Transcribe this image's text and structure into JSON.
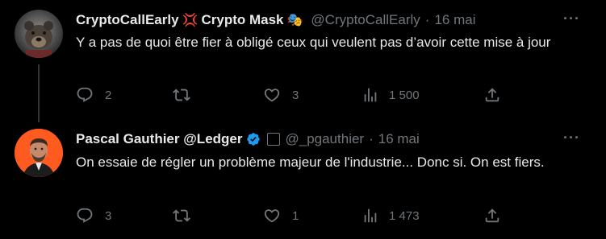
{
  "tweets": [
    {
      "display_name": "CryptoCallEarly",
      "emoji_1": "💢",
      "name_suffix": "Crypto Mask",
      "emoji_2": "🎭",
      "handle": "@CryptoCallEarly",
      "separator": "·",
      "date": "16 mai",
      "text": "Y a pas de quoi être fier à obligé ceux qui veulent pas d’avoir cette mise à jour",
      "replies": "2",
      "retweets": "",
      "likes": "3",
      "views": "1 500",
      "more": "···"
    },
    {
      "display_name": "Pascal Gauthier @Ledger",
      "verified": true,
      "handle": "@_pgauthier",
      "separator": "·",
      "date": "16 mai",
      "text": "On essaie de régler un problème majeur de l'industrie... Donc si. On est fiers.",
      "replies": "3",
      "retweets": "",
      "likes": "1",
      "views": "1 473",
      "more": "···"
    }
  ],
  "colors": {
    "background": "#000000",
    "text": "#e7e9ea",
    "muted": "#71767b",
    "verified": "#1d9bf0",
    "avatar_2_bg": "#ff5a1f"
  }
}
